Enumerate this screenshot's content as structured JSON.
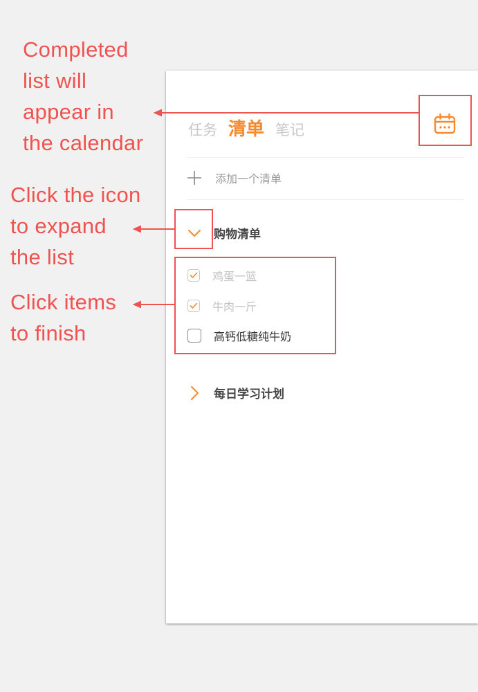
{
  "annotations": {
    "calendar": [
      "Completed",
      "list will",
      "appear in",
      "the calendar"
    ],
    "expand": [
      "Click the icon",
      "to expand",
      "the list"
    ],
    "finish": [
      "Click items",
      "to finish"
    ]
  },
  "tabs": [
    {
      "label": "任务",
      "active": false
    },
    {
      "label": "清单",
      "active": true
    },
    {
      "label": "笔记",
      "active": false
    }
  ],
  "add_list": {
    "label": "添加一个清单",
    "icon": "plus-icon"
  },
  "lists": [
    {
      "title": "购物清单",
      "expanded": true,
      "icon": "chevron-down-icon",
      "items": [
        {
          "label": "鸡蛋一篮",
          "done": true
        },
        {
          "label": "牛肉一斤",
          "done": true
        },
        {
          "label": "高钙低糖纯牛奶",
          "done": false
        }
      ]
    },
    {
      "title": "每日学习计划",
      "expanded": false,
      "icon": "chevron-right-icon",
      "items": []
    }
  ],
  "colors": {
    "accent": "#f7892d",
    "annotation": "#ef5350",
    "background": "#f1f1f1"
  },
  "calendar_icon": "calendar-icon"
}
